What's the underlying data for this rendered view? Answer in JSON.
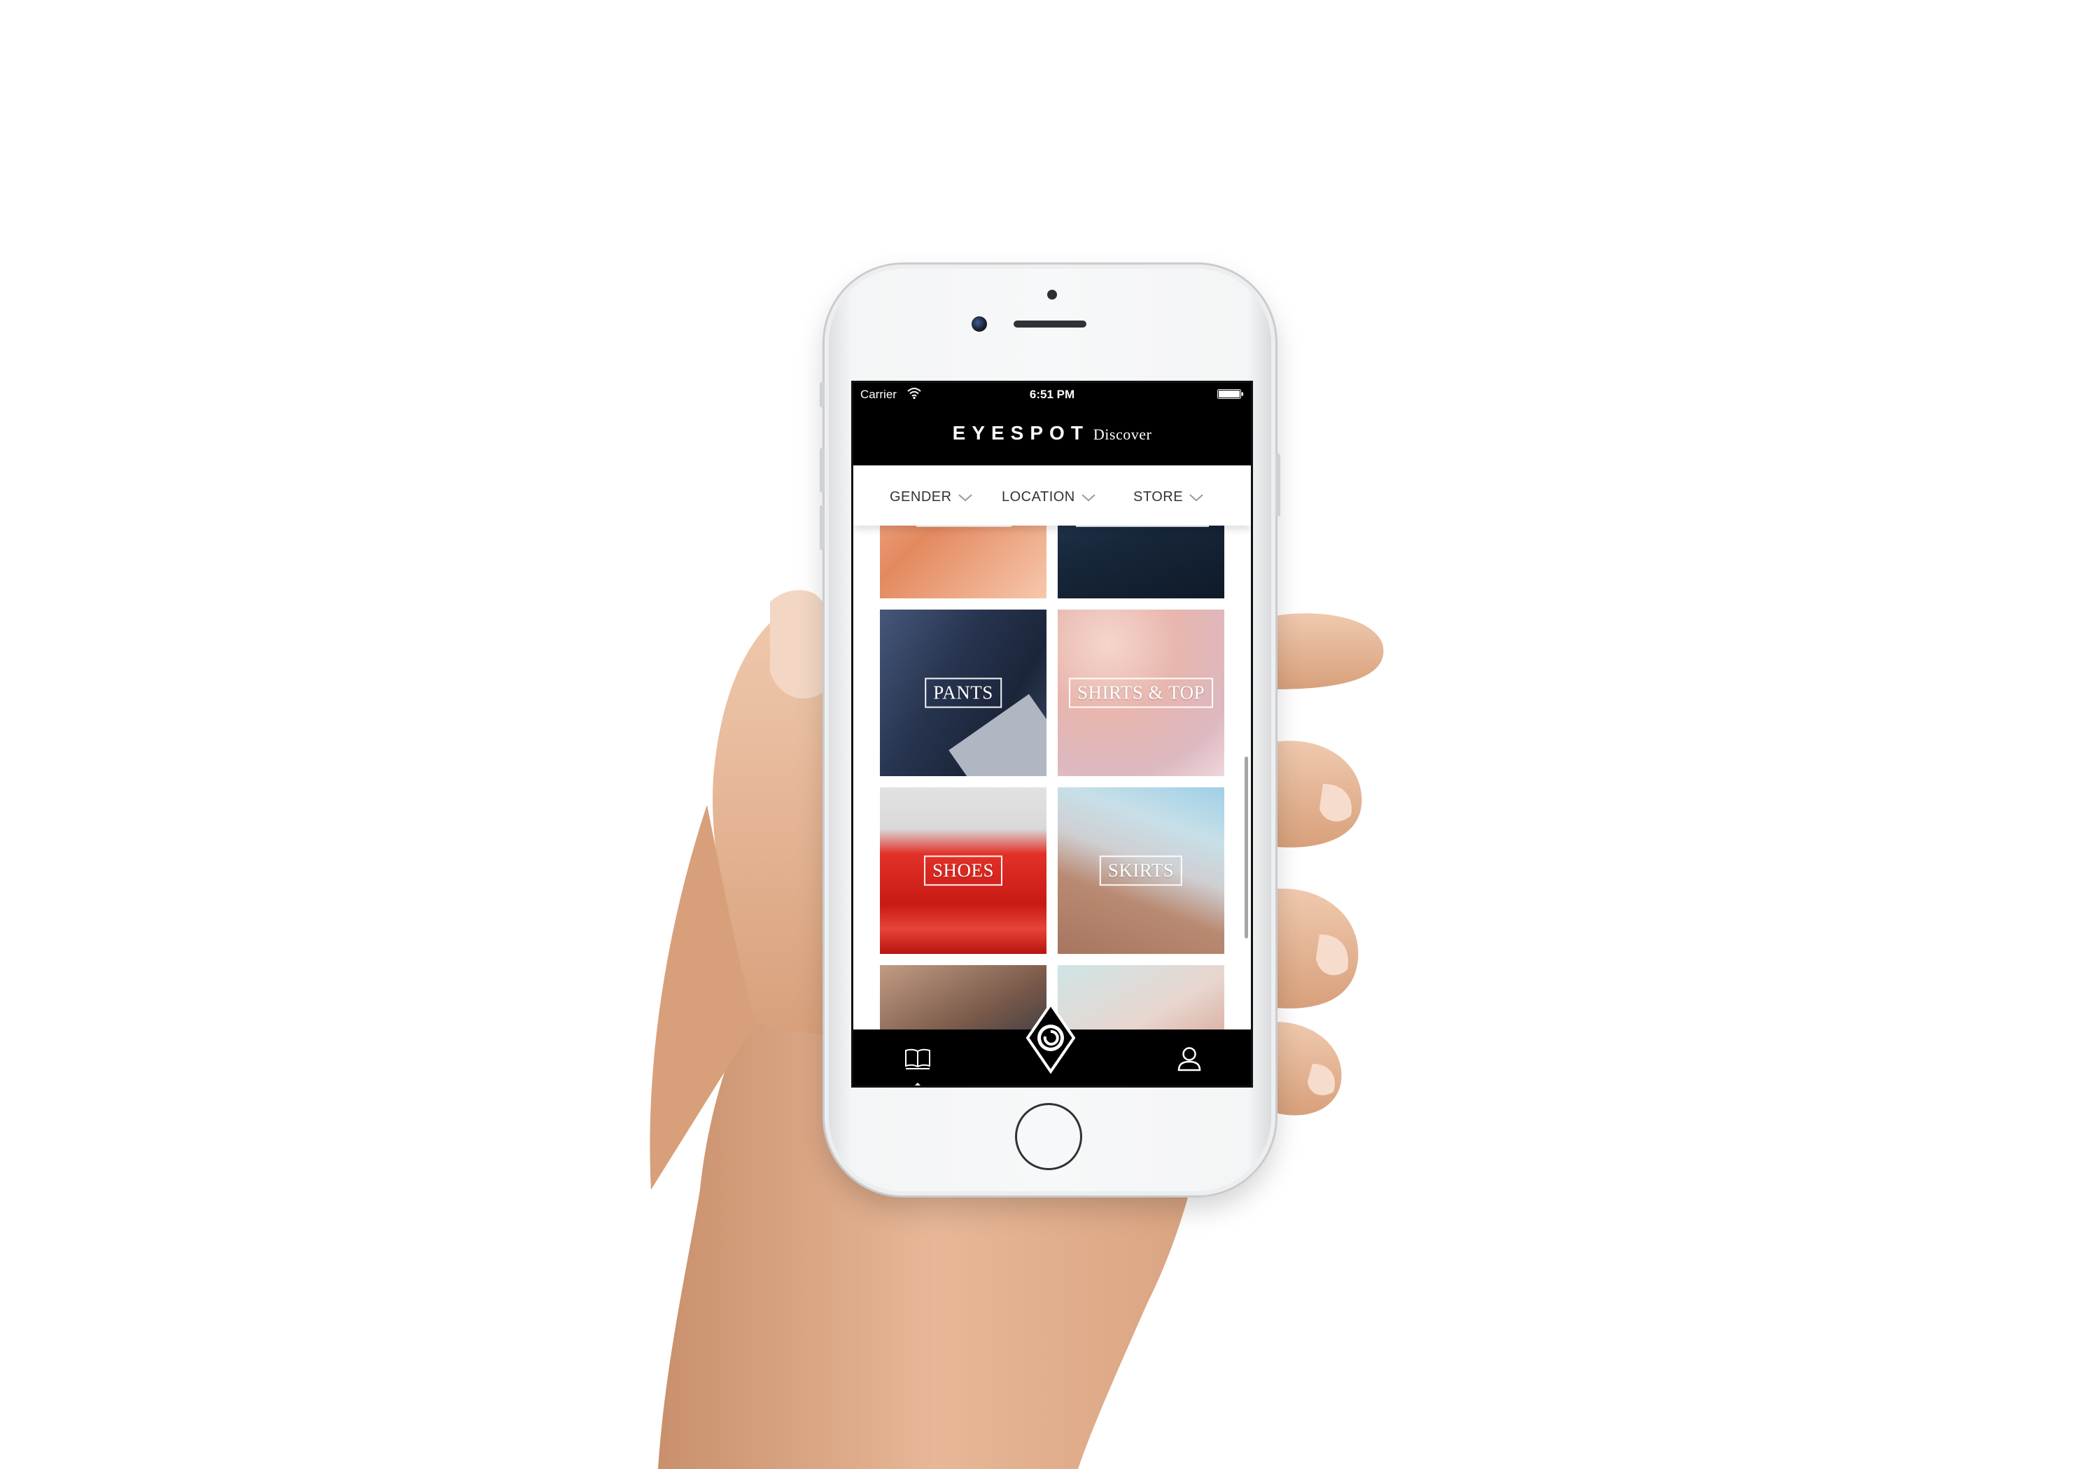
{
  "status_bar": {
    "carrier": "Carrier",
    "time": "6:51 PM"
  },
  "header": {
    "brand": "EYESPOT",
    "subtitle": "Discover"
  },
  "filters": [
    {
      "label": "GENDER"
    },
    {
      "label": "LOCATION"
    },
    {
      "label": "STORE"
    }
  ],
  "categories": [
    {
      "label": "PANTS"
    },
    {
      "label": "SHIRTS & TOP"
    },
    {
      "label": "SHOES"
    },
    {
      "label": "SKIRTS"
    }
  ],
  "tab_bar": {
    "items": [
      {
        "icon": "open-book-icon",
        "active": true
      },
      {
        "icon": "eyespot-camera-icon",
        "active": false
      },
      {
        "icon": "profile-icon",
        "active": false
      }
    ]
  },
  "colors": {
    "bar": "#000000",
    "accent_shoes": "#d42020",
    "pants": "#2b3a56",
    "shirts": "#e4b8b4",
    "skirts": "#8fc6e0",
    "background": "#ffffff"
  }
}
